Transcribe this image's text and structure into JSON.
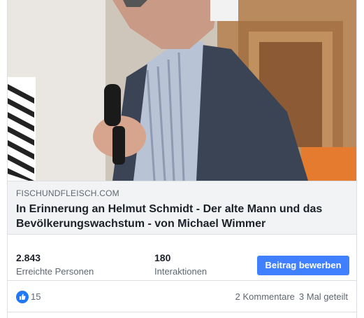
{
  "link": {
    "domain": "FISCHUNDFLEISCH.COM",
    "title": "In Erinnerung an Helmut Schmidt - Der alte Mann und das Bevölkerungswachstum - von Michael Wimmer"
  },
  "stats": {
    "reach_value": "2.843",
    "reach_label": "Erreichte Personen",
    "interactions_value": "180",
    "interactions_label": "Interaktionen"
  },
  "boost_button": {
    "label": "Beitrag bewerben"
  },
  "reactions": {
    "icon": "like-icon",
    "count": "15",
    "comments": "2 Kommentare",
    "shares": "3 Mal geteilt"
  },
  "colors": {
    "accent": "#4080ff",
    "like_blue": "#2078f4",
    "muted_text": "#606770",
    "link_bg": "#f2f3f5"
  }
}
